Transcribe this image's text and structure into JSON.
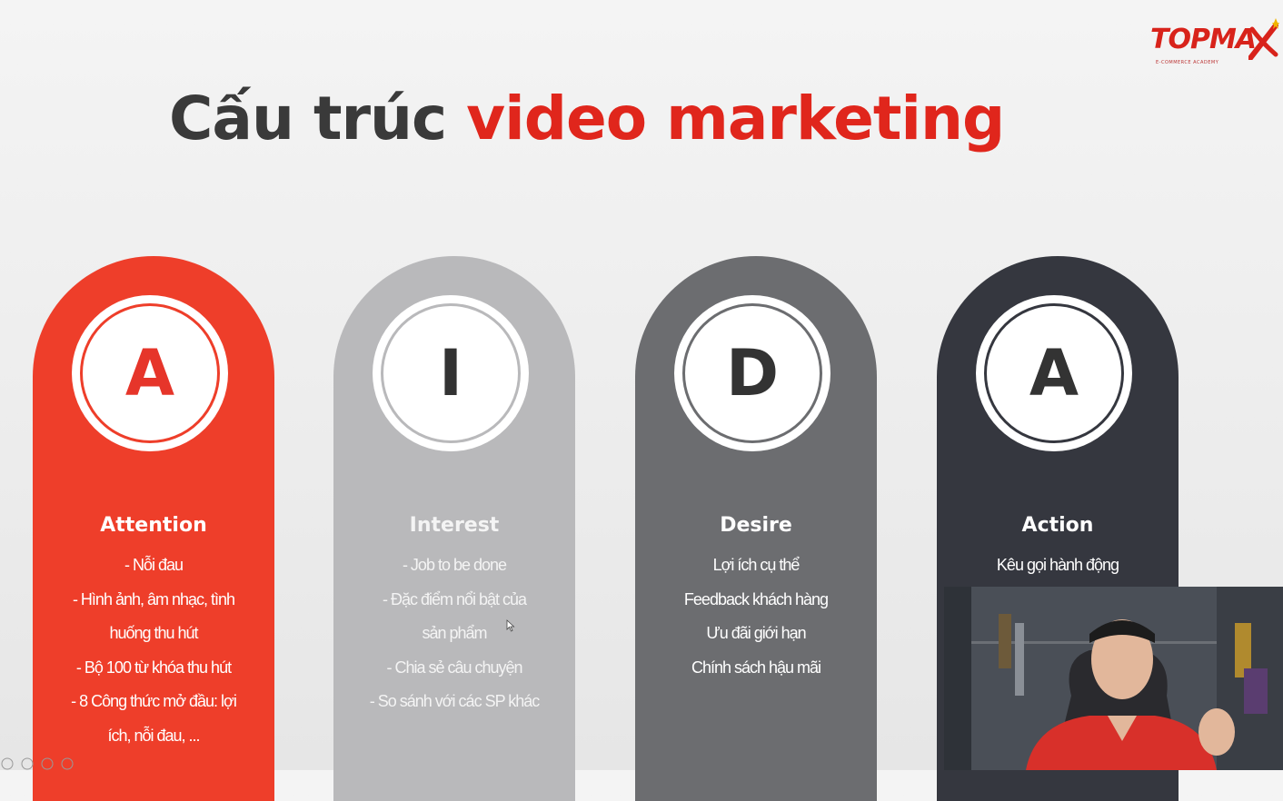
{
  "logo": {
    "text": "TOPMA",
    "subtext": "E-COMMERCE ACADEMY"
  },
  "title": {
    "part1": "Cấu trúc ",
    "part2": "video marketing"
  },
  "colors": {
    "accent": "#e0261c",
    "pillar1": "#ee3e2a",
    "pillar2": "#b9b9bb",
    "pillar3": "#6c6d70",
    "pillar4": "#35373f"
  },
  "pillars": [
    {
      "letter": "A",
      "heading": "Attention",
      "lines": [
        "- Nỗi đau",
        "- Hình ảnh, âm nhạc, tình",
        "huống thu hút",
        "- Bộ 100 từ khóa thu hút",
        "- 8 Công thức mở đầu: lợi",
        "ích, nỗi đau, ..."
      ]
    },
    {
      "letter": "I",
      "heading": "Interest",
      "lines": [
        "- Job to be done",
        "- Đặc điểm nổi bật của",
        "sản phẩm",
        "- Chia sẻ câu chuyện",
        "- So sánh với các SP khác"
      ]
    },
    {
      "letter": "D",
      "heading": "Desire",
      "lines": [
        "Lợi ích cụ thể",
        "Feedback khách hàng",
        "Ưu đãi giới hạn",
        "Chính sách hậu mãi"
      ]
    },
    {
      "letter": "A",
      "heading": "Action",
      "lines": [
        "Kêu gọi hành động"
      ]
    }
  ],
  "icons": {
    "cursor": "mouse-cursor-icon",
    "logo_mark": "x-star-icon"
  }
}
